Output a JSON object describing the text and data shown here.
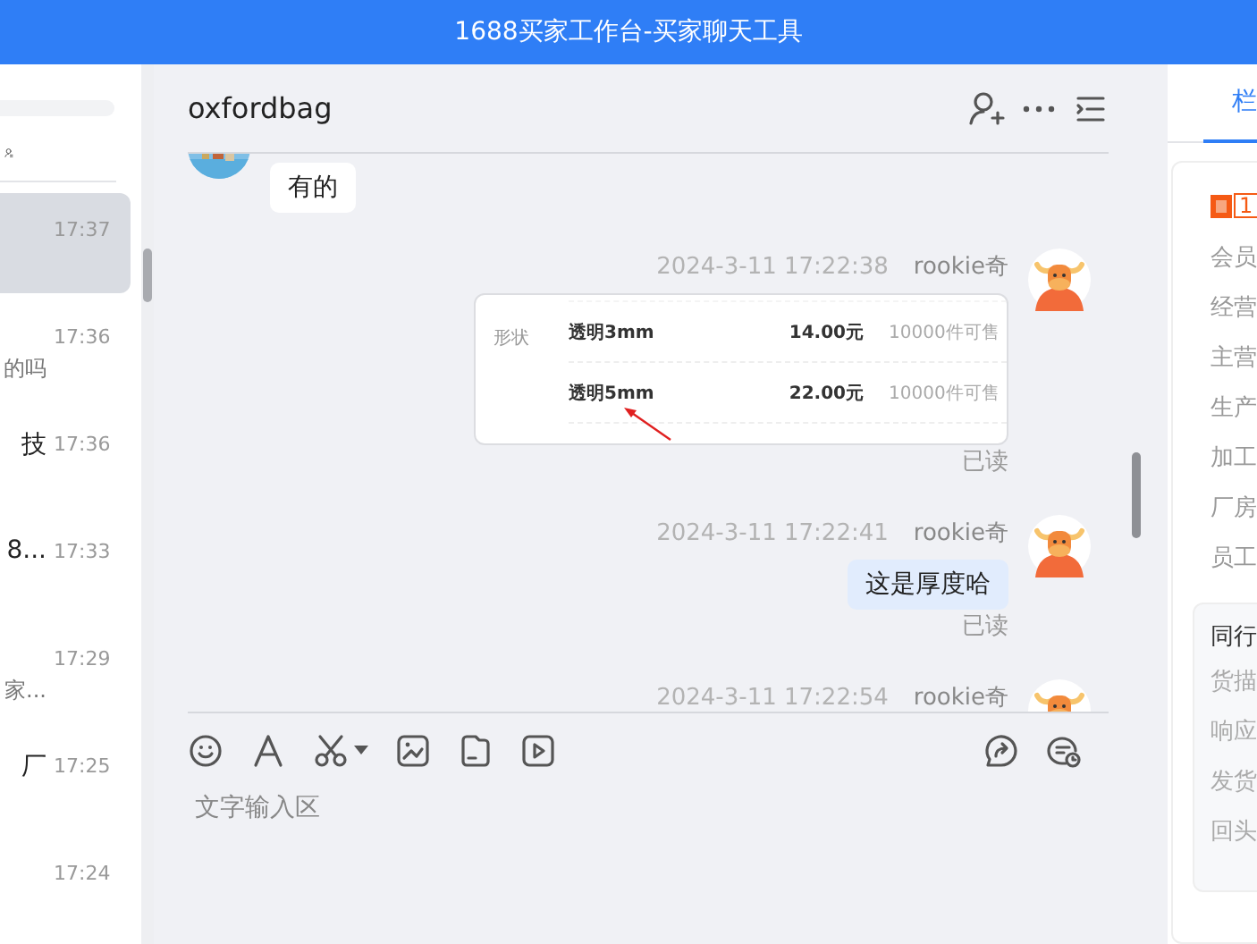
{
  "window": {
    "title": "1688买家工作台-买家聊天工具"
  },
  "conversations": [
    {
      "time": "17:37",
      "selected": true
    },
    {
      "preview": "的吗",
      "time": "17:36",
      "selected": false
    },
    {
      "name": "技",
      "time": "17:36",
      "selected": false
    },
    {
      "name": "8...",
      "time": "17:33",
      "selected": false
    },
    {
      "preview": "家...",
      "time": "17:29",
      "selected": false
    },
    {
      "name": "厂",
      "time": "17:25",
      "selected": false
    },
    {
      "time": "17:24",
      "selected": false
    }
  ],
  "chat": {
    "title": "oxfordbag",
    "messages": [
      {
        "kind": "received_text",
        "text": "有的"
      },
      {
        "kind": "sent_product",
        "time": "2024-3-11 17:22:38",
        "sender": "rookie奇",
        "spec_label": "形状",
        "rows": [
          {
            "option": "透明3mm",
            "price": "14.00元",
            "stock": "10000件可售"
          },
          {
            "option": "透明5mm",
            "price": "22.00元",
            "stock": "10000件可售"
          }
        ],
        "read_status": "已读"
      },
      {
        "kind": "sent_text",
        "time": "2024-3-11 17:22:41",
        "sender": "rookie奇",
        "text": "这是厚度哈",
        "read_status": "已读"
      },
      {
        "kind": "sent_header",
        "time": "2024-3-11 17:22:54",
        "sender": "rookie奇"
      }
    ]
  },
  "input": {
    "placeholder": "文字输入区"
  },
  "side_panel": {
    "tab": {
      "label": "栏",
      "selected": true
    },
    "badge": "1",
    "fields": [
      "会员",
      "经营",
      "主营",
      "生产",
      "加工",
      "厂房",
      "员工"
    ],
    "peer_card": {
      "title": "同行",
      "fields": [
        "货描",
        "响应",
        "发货",
        "回头"
      ]
    }
  }
}
